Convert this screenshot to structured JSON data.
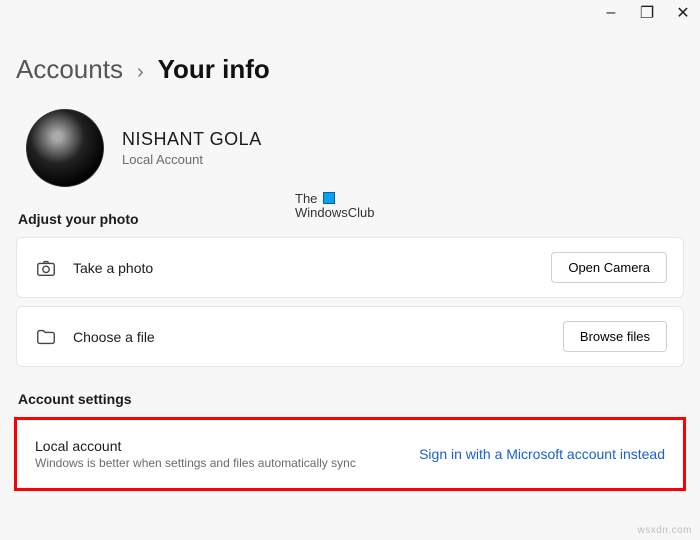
{
  "window_controls": {
    "minimize": "–",
    "maximize": "❐",
    "close": "✕"
  },
  "breadcrumb": {
    "parent": "Accounts",
    "separator": "›",
    "current": "Your info"
  },
  "profile": {
    "name": "NISHANT GOLA",
    "type": "Local Account"
  },
  "watermark": {
    "line1": "The",
    "line2": "WindowsClub"
  },
  "sections": {
    "photo": {
      "title": "Adjust your photo",
      "take_photo_label": "Take a photo",
      "open_camera_btn": "Open Camera",
      "choose_file_label": "Choose a file",
      "browse_files_btn": "Browse files"
    },
    "account": {
      "title": "Account settings",
      "local_title": "Local account",
      "local_desc": "Windows is better when settings and files automatically sync",
      "signin_link": "Sign in with a Microsoft account instead"
    }
  },
  "attribution": "wsxdn.com"
}
